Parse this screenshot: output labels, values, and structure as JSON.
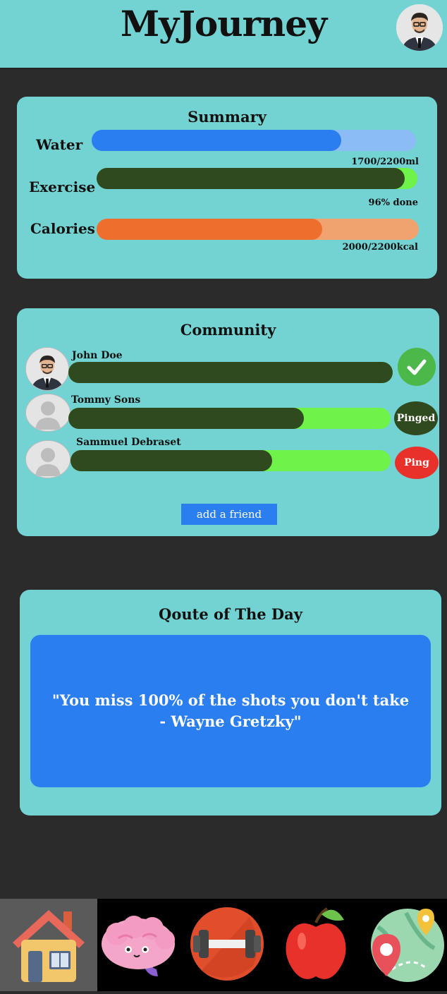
{
  "app": {
    "title": "MyJourney"
  },
  "header": {
    "avatar_icon": "user-avatar"
  },
  "summary": {
    "title": "Summary",
    "items": [
      {
        "label": "Water",
        "progress": 0.77,
        "status": "1700/2200ml",
        "color": "#2a7ef0",
        "track_color": "#8cbcf5"
      },
      {
        "label": "Exercise",
        "progress": 0.96,
        "status": "96% done",
        "color": "#2f4a1e",
        "track_color": "#6ff24a"
      },
      {
        "label": "Calories",
        "progress": 0.7,
        "status": "2000/2200kcal",
        "color": "#ee6f2d",
        "track_color": "#f0a36f"
      }
    ]
  },
  "community": {
    "title": "Community",
    "friends": [
      {
        "name": "John Doe",
        "progress": 1.0,
        "action": "",
        "action_icon": "checkmark-icon",
        "action_color": "#4cb84a"
      },
      {
        "name": "Tommy Sons",
        "progress": 0.73,
        "action": "Pinged",
        "action_color": "#2f4a1e"
      },
      {
        "name": "Sammuel Debraset",
        "progress": 0.63,
        "action": "Ping",
        "action_color": "#e8312a"
      }
    ],
    "add_friend_label": "add a friend"
  },
  "quote": {
    "title": "Qoute of The Day",
    "text": "\"You miss 100% of the shots you don't take - Wayne Gretzky\""
  },
  "nav": {
    "items": [
      {
        "name": "home",
        "icon": "house-icon",
        "active": true
      },
      {
        "name": "mind",
        "icon": "brain-icon",
        "active": false
      },
      {
        "name": "exercise",
        "icon": "dumbbell-icon",
        "active": false
      },
      {
        "name": "nutrition",
        "icon": "apple-icon",
        "active": false
      },
      {
        "name": "map",
        "icon": "map-icon",
        "active": false
      }
    ]
  }
}
